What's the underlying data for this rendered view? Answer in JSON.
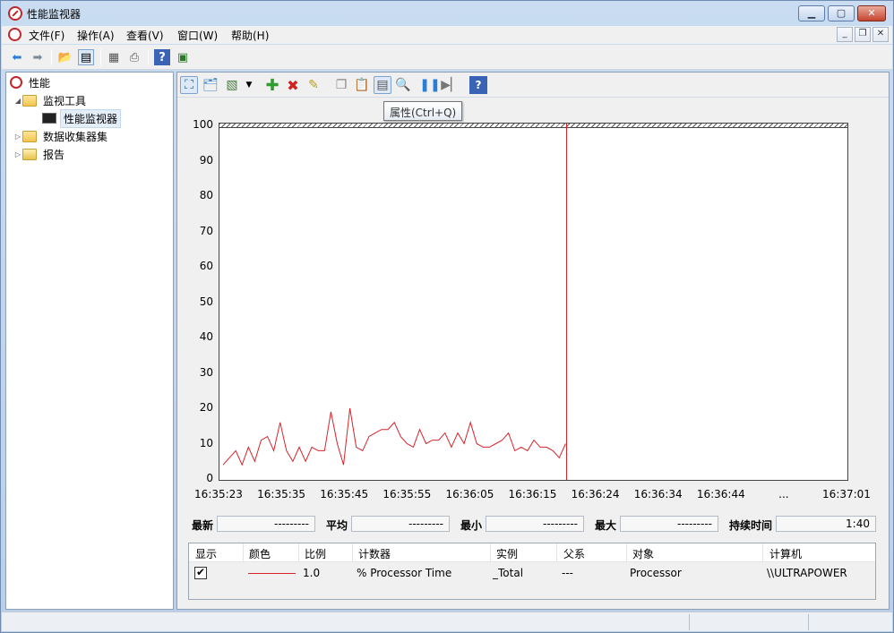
{
  "window": {
    "title": "性能监视器"
  },
  "menu": {
    "items": [
      "文件(F)",
      "操作(A)",
      "查看(V)",
      "窗口(W)",
      "帮助(H)"
    ]
  },
  "tree": {
    "root": "性能",
    "items": [
      {
        "label": "监视工具",
        "expanded": true
      },
      {
        "label": "性能监视器",
        "selected": true
      },
      {
        "label": "数据收集器集"
      },
      {
        "label": "报告"
      }
    ]
  },
  "tooltip": "属性(Ctrl+Q)",
  "chart_data": {
    "type": "line",
    "ylim": [
      0,
      100
    ],
    "yticks": [
      "100",
      "90",
      "80",
      "70",
      "60",
      "50",
      "40",
      "30",
      "20",
      "10",
      "0"
    ],
    "xticks": [
      "16:35:23",
      "16:35:35",
      "16:35:45",
      "16:35:55",
      "16:36:05",
      "16:36:15",
      "16:36:24",
      "16:36:34",
      "16:36:44",
      "...",
      "16:37:01"
    ],
    "color": "#d8232a",
    "series": [
      {
        "values": [
          4,
          6,
          8,
          4,
          9,
          5,
          11,
          12,
          8,
          16,
          8,
          5,
          9,
          5,
          9,
          8,
          8,
          19,
          10,
          4,
          20,
          9,
          8,
          12,
          13,
          14,
          14,
          16,
          12,
          10,
          9,
          14,
          10,
          11,
          11,
          13,
          9,
          13,
          10,
          16,
          10,
          9,
          9,
          10,
          11,
          13,
          8,
          9,
          8,
          11,
          9,
          9,
          8,
          6,
          10
        ]
      }
    ],
    "samples_total": 100
  },
  "stats": {
    "latest_label": "最新",
    "latest_value": "---------",
    "avg_label": "平均",
    "avg_value": "---------",
    "min_label": "最小",
    "min_value": "---------",
    "max_label": "最大",
    "max_value": "---------",
    "duration_label": "持续时间",
    "duration_value": "1:40"
  },
  "legend": {
    "headers": [
      "显示",
      "颜色",
      "比例",
      "计数器",
      "实例",
      "父系",
      "对象",
      "计算机"
    ],
    "row": {
      "show": "✔",
      "scale": "1.0",
      "counter": "% Processor Time",
      "instance": "_Total",
      "parent": "---",
      "object": "Processor",
      "computer": "\\\\ULTRAPOWER"
    }
  }
}
